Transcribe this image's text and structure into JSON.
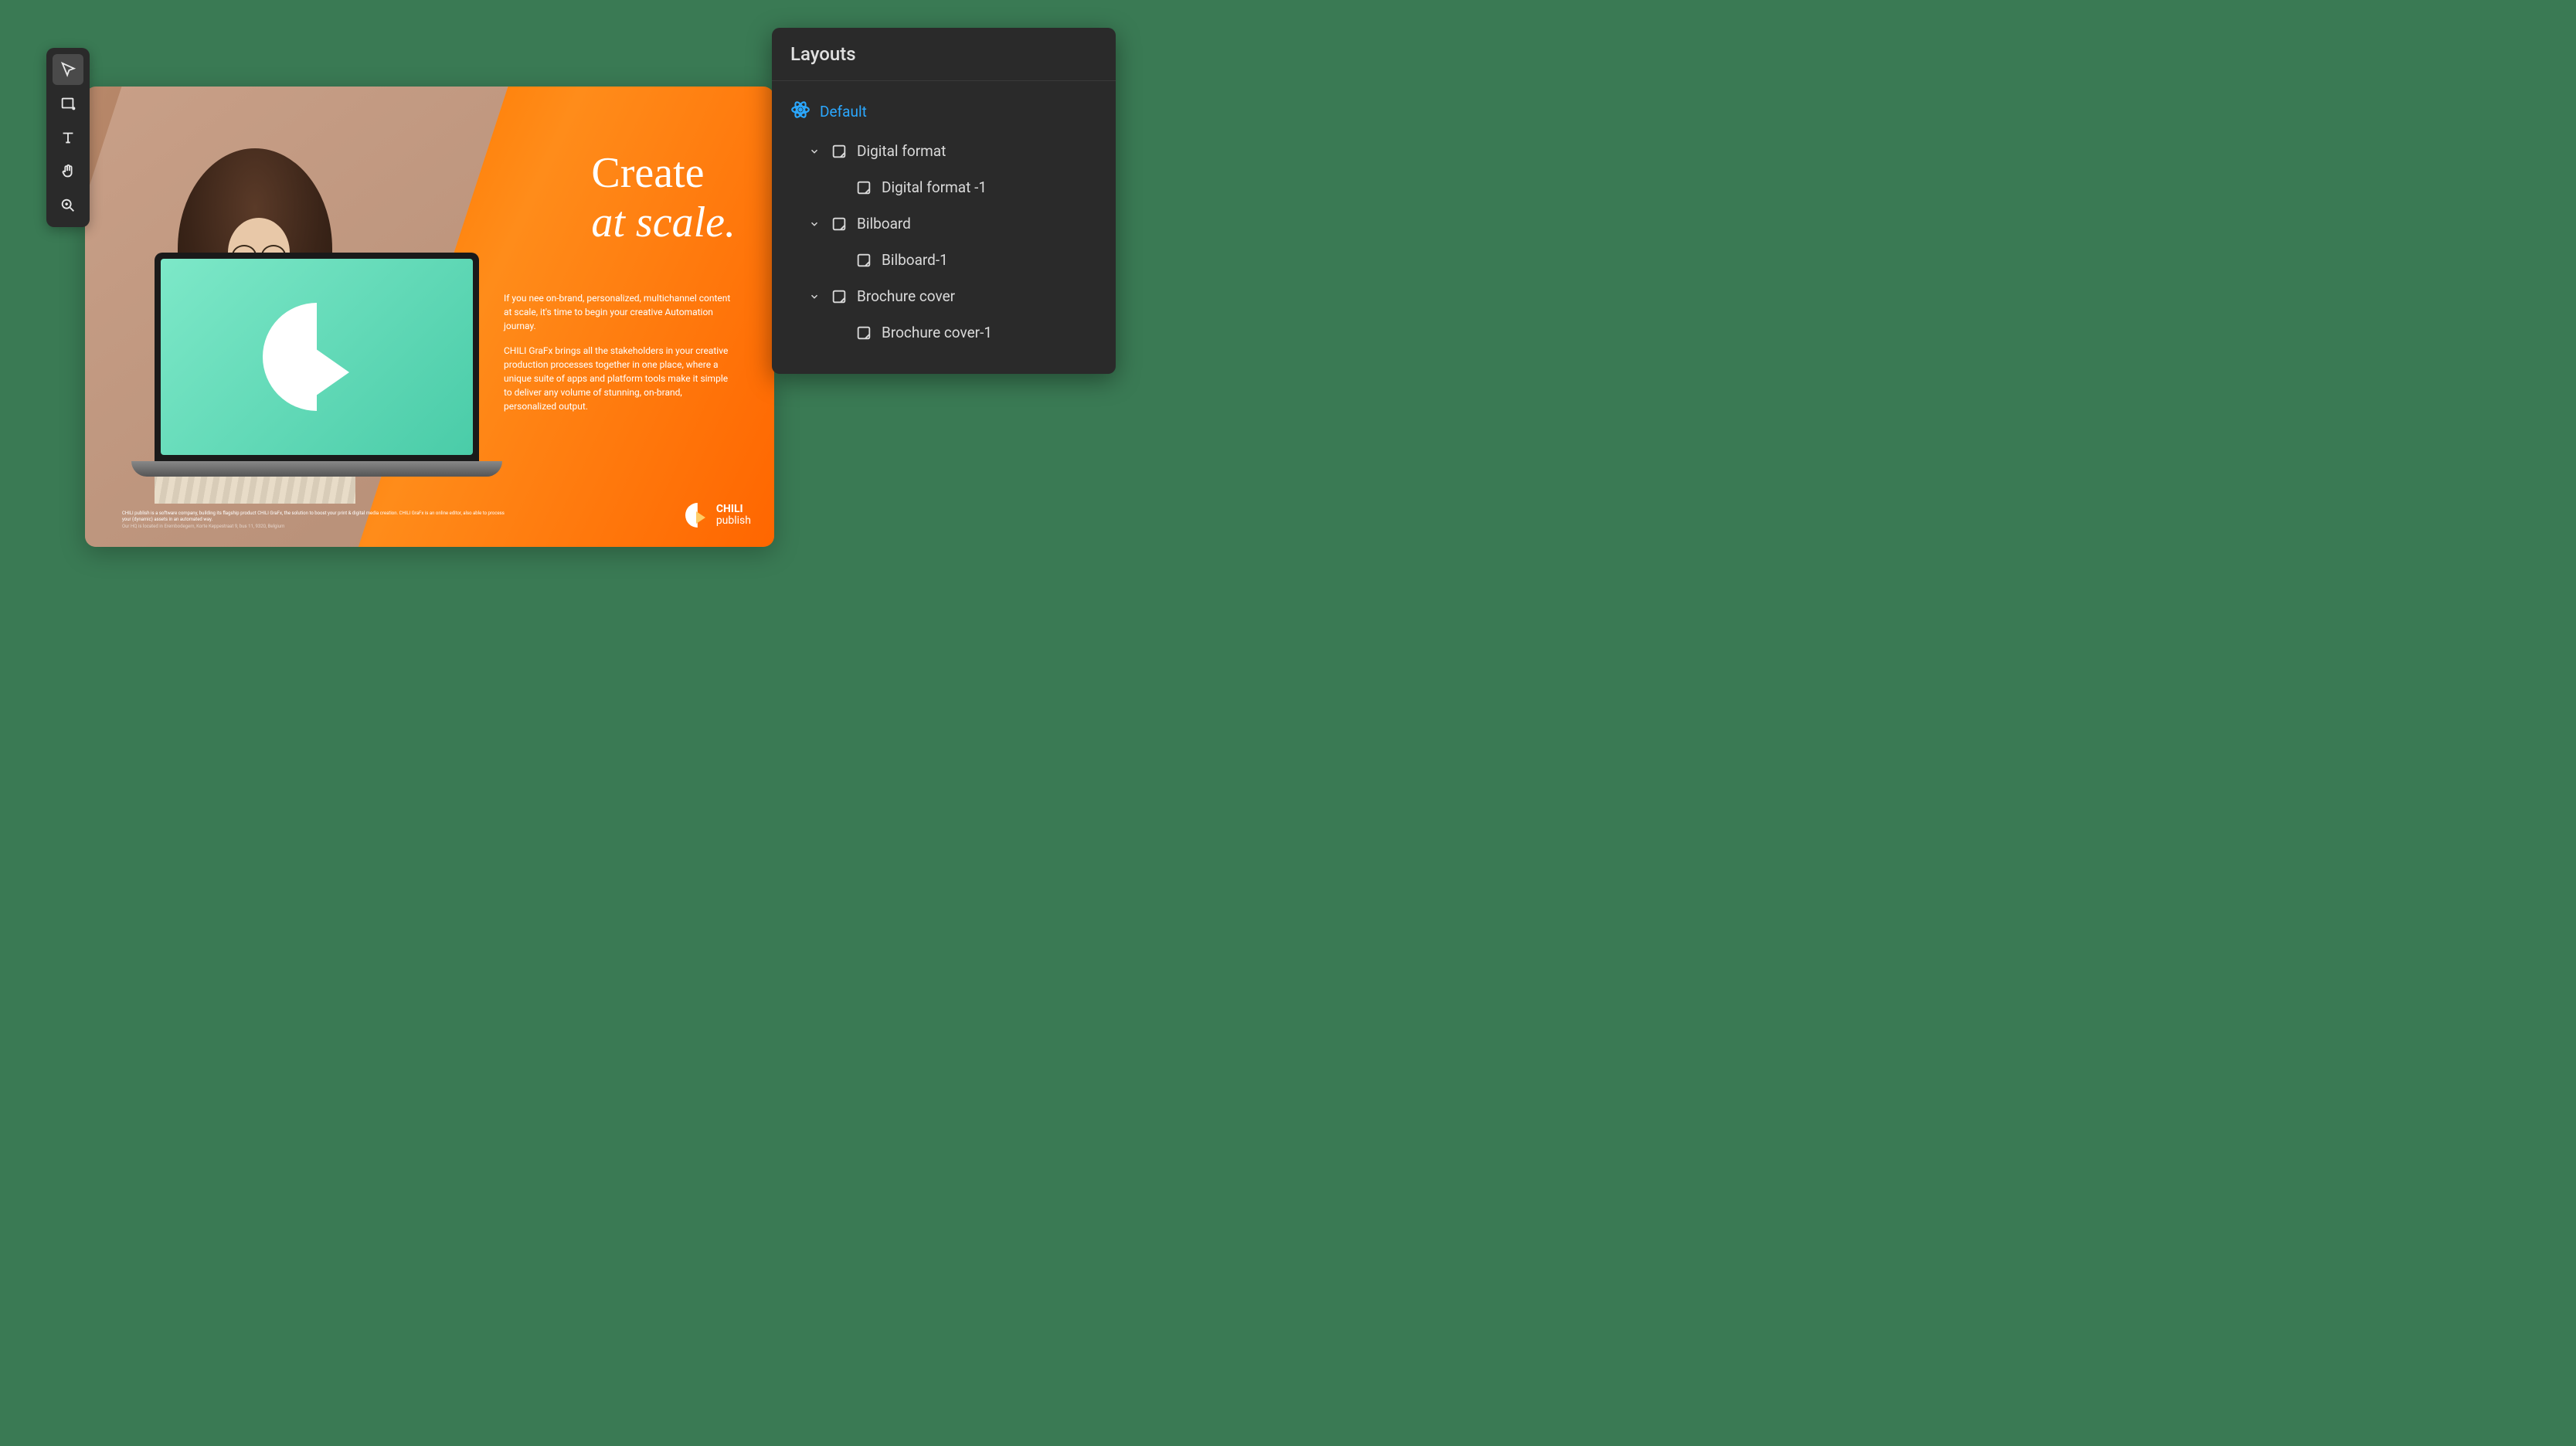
{
  "toolbar": {
    "tools": [
      {
        "name": "select",
        "active": true
      },
      {
        "name": "rectangle",
        "active": false
      },
      {
        "name": "text",
        "active": false
      },
      {
        "name": "hand",
        "active": false
      },
      {
        "name": "zoom",
        "active": false
      }
    ]
  },
  "canvas": {
    "headline1": "Create",
    "headline2": "at scale.",
    "body1": "If you nee on-brand, personalized, multichannel content at scale, it's time to begin your creative Automation journay.",
    "body2": "CHILI GraFx brings all the stakeholders in your creative production processes together in one place, where a unique suite of apps and platform tools make it simple to deliver any volume of stunning, on-brand, personalized output.",
    "brand1": "CHILI",
    "brand2": "publish",
    "footer1": "CHILI publish is a software company, building its flagship product CHILI GraFx, the solution to boost your print & digital media creation. CHILI GraFx is an online editor, also able to process your (dynamic) assets in an automated way.",
    "footer2": "Our HQ is located in Erembodegem, Korte Keppestraat 9, bus 11, 9320, Belgium"
  },
  "panel": {
    "title": "Layouts",
    "root": "Default",
    "tree": [
      {
        "label": "Digital format",
        "expanded": true,
        "children": [
          {
            "label": "Digital format -1"
          }
        ]
      },
      {
        "label": "Bilboard",
        "expanded": true,
        "children": [
          {
            "label": "Bilboard-1"
          }
        ]
      },
      {
        "label": "Brochure cover",
        "expanded": true,
        "children": [
          {
            "label": "Brochure cover-1"
          }
        ]
      }
    ]
  }
}
